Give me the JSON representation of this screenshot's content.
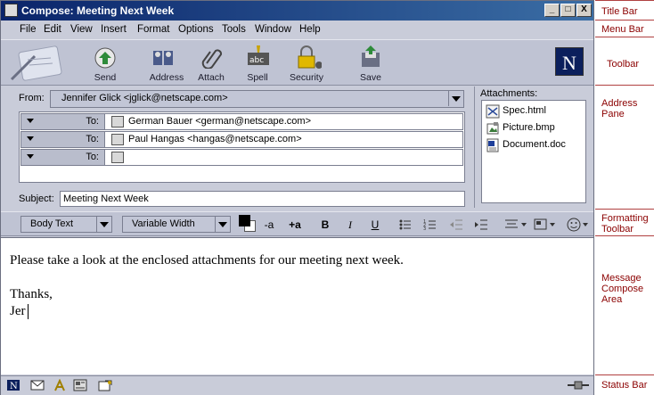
{
  "window": {
    "title": "Compose: Meeting Next Week",
    "controls": [
      "_",
      "□",
      "X"
    ]
  },
  "menu": [
    "File",
    "Edit",
    "View",
    "Insert",
    "Format",
    "Options",
    "Tools",
    "Window",
    "Help"
  ],
  "toolbar": {
    "buttons": [
      {
        "label": "Send",
        "icon": "send-icon"
      },
      {
        "label": "Address",
        "icon": "address-book-icon"
      },
      {
        "label": "Attach",
        "icon": "paperclip-icon"
      },
      {
        "label": "Spell",
        "icon": "spell-check-icon"
      },
      {
        "label": "Security",
        "icon": "padlock-icon"
      },
      {
        "label": "Save",
        "icon": "save-icon"
      }
    ],
    "brand_letter": "N"
  },
  "address": {
    "from_label": "From:",
    "from_value": "Jennifer Glick <jglick@netscape.com>",
    "recipients": [
      {
        "type": "To:",
        "value": "German Bauer <german@netscape.com>"
      },
      {
        "type": "To:",
        "value": "Paul Hangas <hangas@netscape.com>"
      },
      {
        "type": "To:",
        "value": ""
      }
    ],
    "subject_label": "Subject:",
    "subject_value": "Meeting Next Week",
    "attachments_label": "Attachments:",
    "attachments": [
      "Spec.html",
      "Picture.bmp",
      "Document.doc"
    ]
  },
  "format_toolbar": {
    "paragraph_style": "Body Text",
    "font": "Variable Width",
    "buttons": [
      "-a",
      "+a",
      "B",
      "I",
      "U"
    ]
  },
  "compose": {
    "lines": [
      "Please  take a look at the enclosed attachments for our meeting next week.",
      "",
      "Thanks,",
      "Jer"
    ]
  },
  "annotations": [
    "Title Bar",
    "Menu Bar",
    "Toolbar",
    "Address Pane",
    "Formatting Toolbar",
    "Message Compose Area",
    "Status Bar"
  ],
  "colors": {
    "titlebar": "#0a246a",
    "chrome": "#c9ccd9",
    "annotation": "#8b0000",
    "brand": "#0b1f5c"
  }
}
